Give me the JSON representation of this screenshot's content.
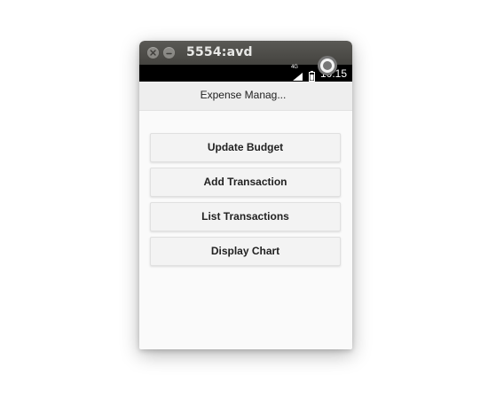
{
  "window": {
    "title": "5554:avd"
  },
  "status_bar": {
    "network_label": "4G",
    "time": "10:15"
  },
  "action_bar": {
    "title": "Expense Manag..."
  },
  "buttons": [
    {
      "label": "Update Budget"
    },
    {
      "label": "Add Transaction"
    },
    {
      "label": "List Transactions"
    },
    {
      "label": "Display Chart"
    }
  ],
  "colors": {
    "titlebar": "#4f4e4a",
    "statusbar": "#000000",
    "actionbar": "#eeeeee",
    "button_bg": "#f3f3f3",
    "text": "#222222"
  }
}
